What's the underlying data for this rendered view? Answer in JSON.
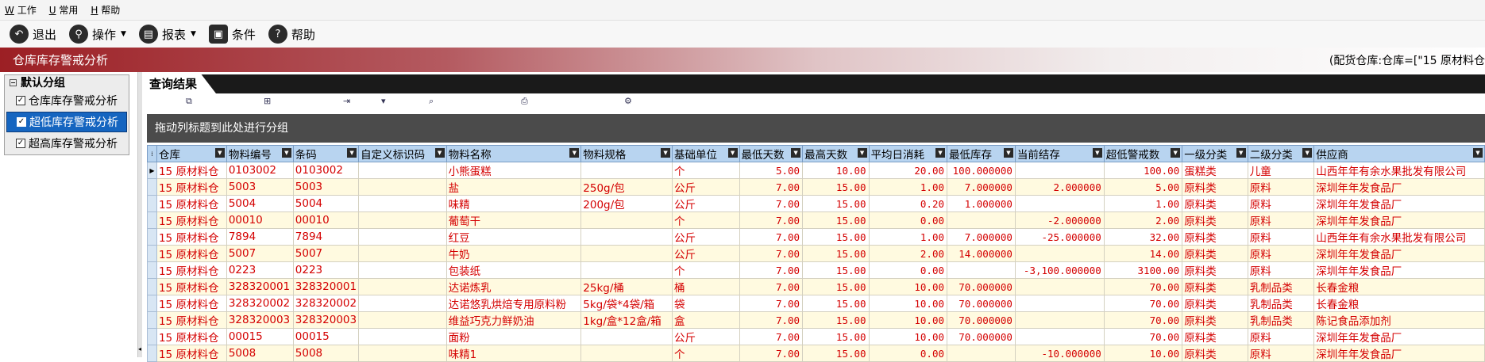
{
  "menu": [
    {
      "hotkey": "W",
      "label": "工作"
    },
    {
      "hotkey": "U",
      "label": "常用"
    },
    {
      "hotkey": "H",
      "label": "帮助"
    }
  ],
  "toolbar": {
    "exit": "退出",
    "operate": "操作",
    "report": "报表",
    "condition": "条件",
    "help": "帮助"
  },
  "window": {
    "title": "仓库库存警戒分析",
    "filter_text": "(配货仓库:仓库=[\"15  原材料仓"
  },
  "left_panel": {
    "group_title": "默认分组",
    "items": [
      {
        "label": "仓库库存警戒分析",
        "checked": true,
        "selected": false
      },
      {
        "label": "超低库存警戒分析",
        "checked": true,
        "selected": true
      },
      {
        "label": "超高库存警戒分析",
        "checked": true,
        "selected": false
      }
    ]
  },
  "results": {
    "tab_label": "查询结果",
    "group_hint": "拖动列标题到此处进行分组",
    "columns": [
      "仓库",
      "物料编号",
      "条码",
      "自定义标识码",
      "物料名称",
      "物料规格",
      "基础单位",
      "最低天数",
      "最高天数",
      "平均日消耗",
      "最低库存",
      "当前结存",
      "超低警戒数",
      "一级分类",
      "二级分类",
      "供应商"
    ],
    "rows": [
      [
        "15  原材料仓",
        "0103002",
        "0103002",
        "",
        "小熊蛋糕",
        "",
        "个",
        "5.00",
        "10.00",
        "20.00",
        "100.000000",
        "",
        "100.00",
        "蛋糕类",
        "儿童",
        "山西年年有余水果批发有限公司"
      ],
      [
        "15  原材料仓",
        "5003",
        "5003",
        "",
        "盐",
        "250g/包",
        "公斤",
        "7.00",
        "15.00",
        "1.00",
        "7.000000",
        "2.000000",
        "5.00",
        "原料类",
        "原料",
        "深圳年年发食品厂"
      ],
      [
        "15  原材料仓",
        "5004",
        "5004",
        "",
        "味精",
        "200g/包",
        "公斤",
        "7.00",
        "15.00",
        "0.20",
        "1.000000",
        "",
        "1.00",
        "原料类",
        "原料",
        "深圳年年发食品厂"
      ],
      [
        "15  原材料仓",
        "00010",
        "00010",
        "",
        "葡萄干",
        "",
        "个",
        "7.00",
        "15.00",
        "0.00",
        "",
        "-2.000000",
        "2.00",
        "原料类",
        "原料",
        "深圳年年发食品厂"
      ],
      [
        "15  原材料仓",
        "7894",
        "7894",
        "",
        "红豆",
        "",
        "公斤",
        "7.00",
        "15.00",
        "1.00",
        "7.000000",
        "-25.000000",
        "32.00",
        "原料类",
        "原料",
        "山西年年有余水果批发有限公司"
      ],
      [
        "15  原材料仓",
        "5007",
        "5007",
        "",
        "牛奶",
        "",
        "公斤",
        "7.00",
        "15.00",
        "2.00",
        "14.000000",
        "",
        "14.00",
        "原料类",
        "原料",
        "深圳年年发食品厂"
      ],
      [
        "15  原材料仓",
        "0223",
        "0223",
        "",
        "包装纸",
        "",
        "个",
        "7.00",
        "15.00",
        "0.00",
        "",
        "-3,100.000000",
        "3100.00",
        "原料类",
        "原料",
        "深圳年年发食品厂"
      ],
      [
        "15  原材料仓",
        "328320001",
        "328320001",
        "",
        "达诺炼乳",
        "25kg/桶",
        "桶",
        "7.00",
        "15.00",
        "10.00",
        "70.000000",
        "",
        "70.00",
        "原料类",
        "乳制品类",
        "长春金粮"
      ],
      [
        "15  原材料仓",
        "328320002",
        "328320002",
        "",
        "达诺悠乳烘焙专用原料粉",
        "5kg/袋*4袋/箱",
        "袋",
        "7.00",
        "15.00",
        "10.00",
        "70.000000",
        "",
        "70.00",
        "原料类",
        "乳制品类",
        "长春金粮"
      ],
      [
        "15  原材料仓",
        "328320003",
        "328320003",
        "",
        "维益巧克力鲜奶油",
        "1kg/盒*12盒/箱",
        "盒",
        "7.00",
        "15.00",
        "10.00",
        "70.000000",
        "",
        "70.00",
        "原料类",
        "乳制品类",
        "陈记食品添加剂"
      ],
      [
        "15  原材料仓",
        "00015",
        "00015",
        "",
        "面粉",
        "",
        "公斤",
        "7.00",
        "15.00",
        "10.00",
        "70.000000",
        "",
        "70.00",
        "原料类",
        "原料",
        "深圳年年发食品厂"
      ],
      [
        "15  原材料仓",
        "5008",
        "5008",
        "",
        "味精1",
        "",
        "个",
        "7.00",
        "15.00",
        "0.00",
        "",
        "-10.000000",
        "10.00",
        "原料类",
        "原料",
        "深圳年年发食品厂"
      ]
    ]
  }
}
